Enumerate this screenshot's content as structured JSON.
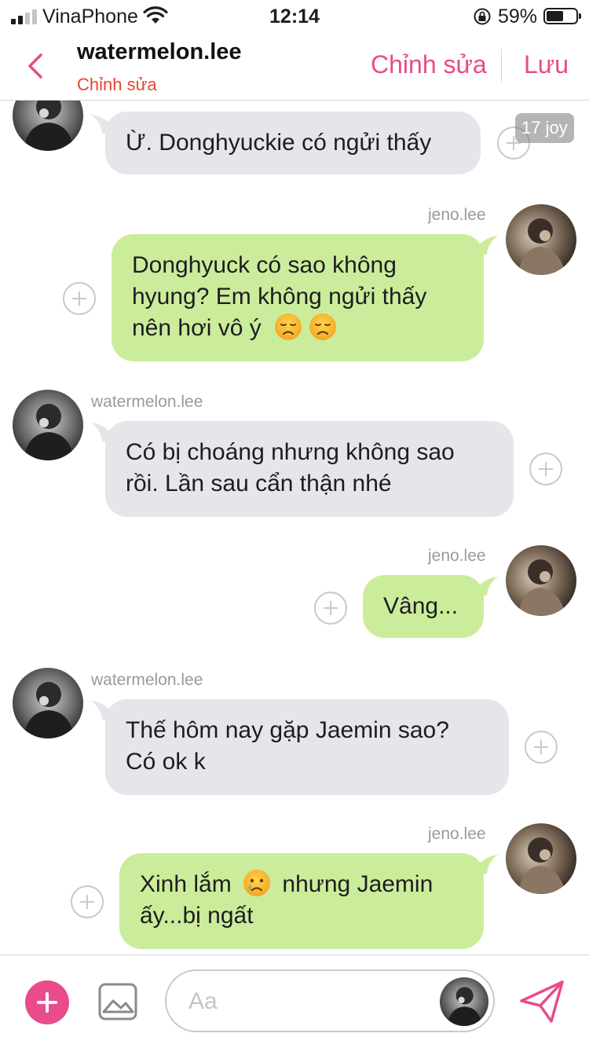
{
  "status_bar": {
    "carrier": "VinaPhone",
    "time": "12:14",
    "battery_percent": "59%",
    "battery_level": 0.59,
    "icons": [
      "signal-icon",
      "wifi-icon",
      "orientation-lock-icon",
      "battery-icon"
    ]
  },
  "header": {
    "title": "watermelon.lee",
    "subtitle": "Chỉnh sửa",
    "edit_label": "Chỉnh sửa",
    "save_label": "Lưu",
    "back_icon": "chevron-left-icon"
  },
  "overlay": {
    "badge": "17 joy"
  },
  "messages": [
    {
      "direction": "in",
      "sender": "",
      "lines": [
        "Ừ. Donghyuckie có ngửi thấy"
      ]
    },
    {
      "direction": "out",
      "sender": "jeno.lee",
      "lines": [
        "Donghyuck có sao không",
        "hyung? Em không ngửi thấy",
        "nên hơi vô ý"
      ],
      "trailing_emoji": [
        "disappointed-face-emoji",
        "disappointed-face-emoji"
      ]
    },
    {
      "direction": "in",
      "sender": "watermelon.lee",
      "lines": [
        "Có bị choáng nhưng không sao",
        "rồi. Lần sau cẩn thận nhé"
      ]
    },
    {
      "direction": "out",
      "sender": "jeno.lee",
      "lines": [
        "Vâng..."
      ]
    },
    {
      "direction": "in",
      "sender": "watermelon.lee",
      "lines": [
        "Thế hôm nay gặp Jaemin sao?",
        "Có ok k"
      ]
    },
    {
      "direction": "out",
      "sender": "jeno.lee",
      "lines": [
        "Xinh lắm",
        "nhưng Jaemin",
        "ấy...bị ngất"
      ],
      "inline_emoji": "crying-face-emoji"
    }
  ],
  "input_bar": {
    "placeholder": "Aa",
    "value": "",
    "add_icon": "plus-icon",
    "image_icon": "image-icon",
    "send_icon": "send-icon"
  },
  "colors": {
    "accent": "#e84c8a",
    "subtitle": "#e8452d",
    "incoming_bubble": "#e4e6ea",
    "outgoing_bubble": "#cbed9b"
  }
}
